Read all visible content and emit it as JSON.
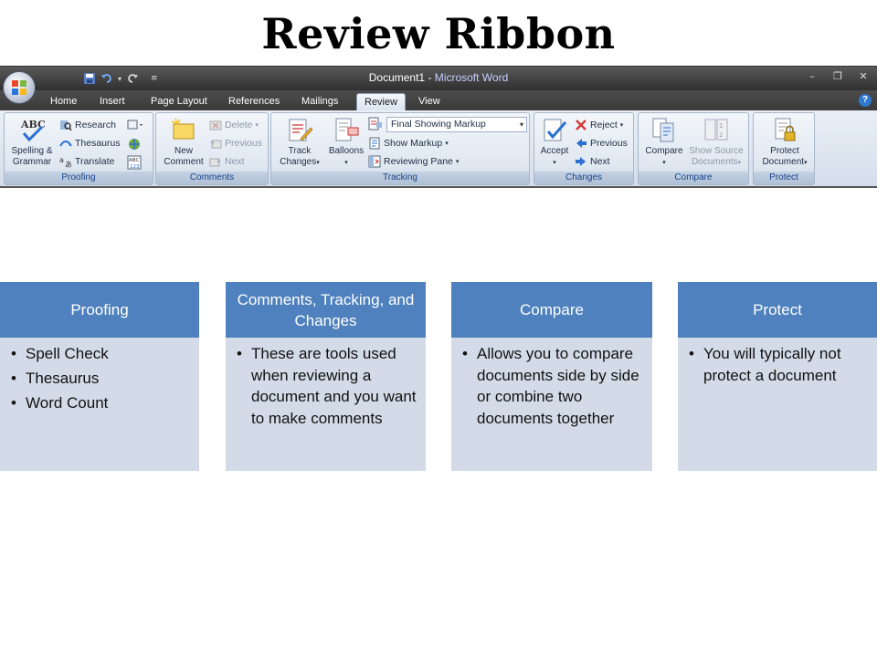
{
  "slide": {
    "title": "Review Ribbon"
  },
  "window": {
    "doc_name": "Document1",
    "separator": " - ",
    "app_name": "Microsoft Word",
    "tabs": [
      "Home",
      "Insert",
      "Page Layout",
      "References",
      "Mailings",
      "Review",
      "View"
    ],
    "active_tab": "Review"
  },
  "ribbon": {
    "proofing": {
      "label": "Proofing",
      "spelling": "Spelling &",
      "spelling2": "Grammar",
      "research": "Research",
      "thesaurus": "Thesaurus",
      "translate": "Translate"
    },
    "comments": {
      "label": "Comments",
      "new_comment": "New",
      "new_comment2": "Comment",
      "delete": "Delete",
      "previous": "Previous",
      "next": "Next"
    },
    "tracking": {
      "label": "Tracking",
      "track_changes": "Track",
      "track_changes2": "Changes",
      "balloons": "Balloons",
      "markup_select": "Final Showing Markup",
      "show_markup": "Show Markup",
      "reviewing_pane": "Reviewing Pane"
    },
    "changes": {
      "label": "Changes",
      "accept": "Accept",
      "reject": "Reject",
      "previous": "Previous",
      "next": "Next"
    },
    "compare": {
      "label": "Compare",
      "compare_btn": "Compare",
      "show_source": "Show Source",
      "show_source2": "Documents"
    },
    "protect": {
      "label": "Protect",
      "protect_btn": "Protect",
      "protect_btn2": "Document"
    }
  },
  "cards": [
    {
      "header": "Proofing",
      "items": [
        "Spell Check",
        "Thesaurus",
        "Word Count"
      ]
    },
    {
      "header": "Comments, Tracking, and Changes",
      "items": [
        "These are tools used when reviewing a document and you want to make comments"
      ]
    },
    {
      "header": "Compare",
      "items": [
        "Allows you to compare documents side by side or combine two documents together"
      ]
    },
    {
      "header": "Protect",
      "items": [
        "You will typically not protect a document"
      ]
    }
  ],
  "colors": {
    "card_header": "#4e81bd",
    "card_body": "#d3dbe8",
    "ribbon_label": "#15428b"
  }
}
